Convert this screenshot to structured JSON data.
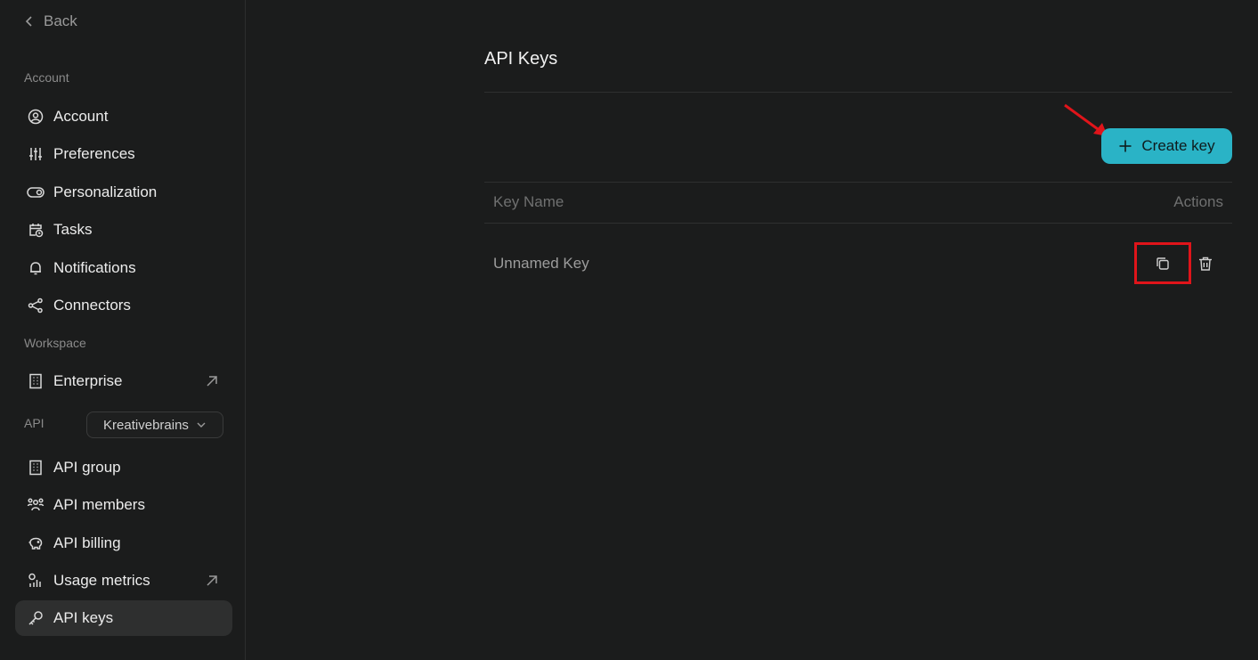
{
  "sidebar": {
    "back_label": "Back",
    "account_section": "Account",
    "account_items": [
      {
        "label": "Account",
        "icon": "user-circle-icon"
      },
      {
        "label": "Preferences",
        "icon": "sliders-icon"
      },
      {
        "label": "Personalization",
        "icon": "toggle-icon"
      },
      {
        "label": "Tasks",
        "icon": "calendar-clock-icon"
      },
      {
        "label": "Notifications",
        "icon": "bell-icon"
      },
      {
        "label": "Connectors",
        "icon": "share-nodes-icon"
      }
    ],
    "workspace_section": "Workspace",
    "workspace_items": [
      {
        "label": "Enterprise",
        "icon": "building-icon",
        "external": true
      }
    ],
    "api_section": "API",
    "api_selector": {
      "value": "Kreativebrains"
    },
    "api_items": [
      {
        "label": "API group",
        "icon": "building-icon"
      },
      {
        "label": "API members",
        "icon": "users-icon"
      },
      {
        "label": "API billing",
        "icon": "piggy-bank-icon"
      },
      {
        "label": "Usage metrics",
        "icon": "chart-icon",
        "external": true
      },
      {
        "label": "API keys",
        "icon": "key-icon",
        "active": true
      }
    ]
  },
  "main": {
    "title": "API Keys",
    "create_button": "Create key",
    "table": {
      "columns": [
        "Key Name",
        "Actions"
      ],
      "rows": [
        {
          "name": "Unnamed Key"
        }
      ]
    }
  },
  "colors": {
    "background": "#1b1c1c",
    "accent": "#2ab3c6",
    "annotation": "#e0141a"
  }
}
